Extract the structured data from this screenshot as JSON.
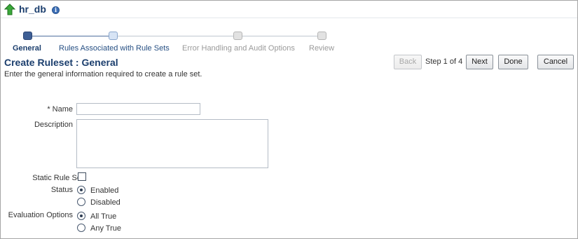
{
  "header": {
    "title": "hr_db",
    "up_icon": "green-up-arrow-icon",
    "info_icon": "info-icon"
  },
  "train": {
    "steps": [
      {
        "label": "General",
        "state": "current"
      },
      {
        "label": "Rules Associated with Rule Sets",
        "state": "next"
      },
      {
        "label": "Error Handling and Audit Options",
        "state": "disabled"
      },
      {
        "label": "Review",
        "state": "disabled"
      }
    ]
  },
  "page": {
    "title": "Create Ruleset : General",
    "description": "Enter the general information required to create a rule set."
  },
  "nav": {
    "back_label": "Back",
    "step_text": "Step 1 of 4",
    "next_label": "Next",
    "done_label": "Done",
    "cancel_label": "Cancel"
  },
  "form": {
    "name_required_marker": "*",
    "name_label": "Name",
    "name_value": "",
    "description_label": "Description",
    "description_value": "",
    "static_rule_set_label": "Static Rule Set",
    "static_rule_set_checked": false,
    "status_label": "Status",
    "status_options": [
      {
        "label": "Enabled",
        "checked": true
      },
      {
        "label": "Disabled",
        "checked": false
      }
    ],
    "evaluation_label": "Evaluation Options",
    "evaluation_options": [
      {
        "label": "All True",
        "checked": true
      },
      {
        "label": "Any True",
        "checked": false
      }
    ]
  },
  "colors": {
    "title_blue": "#1b3e6d",
    "link_blue": "#264f83",
    "disabled_gray": "#9a9a9a",
    "icon_green": "#2e9e2e"
  }
}
